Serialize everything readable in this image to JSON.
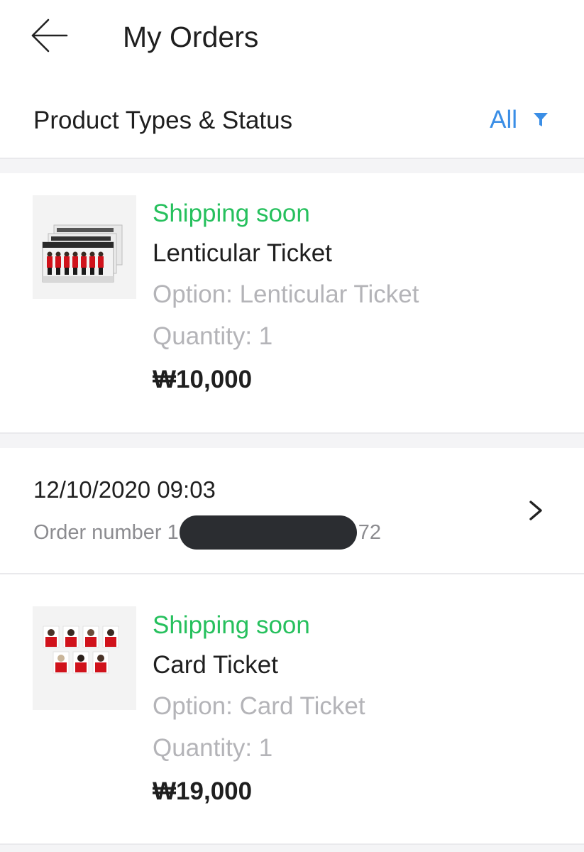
{
  "header": {
    "title": "My Orders",
    "back_icon": "arrow-left-icon"
  },
  "filter": {
    "label": "Product Types & Status",
    "value": "All",
    "icon": "filter-funnel-icon",
    "accent_color": "#3a8ee6"
  },
  "orders": [
    {
      "status": "Shipping soon",
      "name": "Lenticular Ticket",
      "option": "Option: Lenticular Ticket",
      "quantity": "Quantity: 1",
      "price": "₩10,000"
    },
    {
      "status": "Shipping soon",
      "name": "Card Ticket",
      "option": "Option: Card Ticket",
      "quantity": "Quantity: 1",
      "price": "₩19,000"
    }
  ],
  "order_group": {
    "date": "12/10/2020 09:03",
    "number_prefix": "Order number 1",
    "number_suffix": "72",
    "chevron_icon": "chevron-right-icon"
  },
  "colors": {
    "status_green": "#26c05d",
    "muted_text": "#b4b4b8",
    "section_gap": "#f4f4f6"
  }
}
